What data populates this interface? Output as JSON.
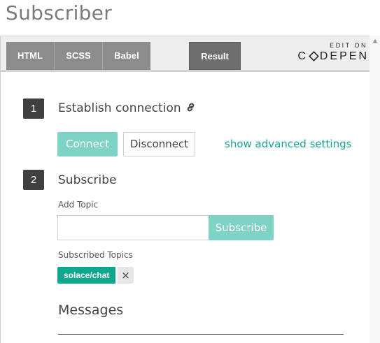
{
  "page": {
    "title": "Subscriber"
  },
  "embed": {
    "tabs": [
      {
        "label": "HTML"
      },
      {
        "label": "SCSS"
      },
      {
        "label": "Babel"
      }
    ],
    "result_tab": "Result",
    "edit_on": "EDIT ON",
    "codepen_brand": {
      "pre": "C",
      "post": "DEPEN"
    }
  },
  "steps": {
    "step1": {
      "number": "1",
      "title": "Establish connection",
      "connect_label": "Connect",
      "disconnect_label": "Disconnect",
      "advanced_link": "show advanced settings"
    },
    "step2": {
      "number": "2",
      "title": "Subscribe",
      "add_topic_label": "Add Topic",
      "topic_input_value": "",
      "subscribe_label": "Subscribe",
      "subscribed_topics_label": "Subscribed Topics",
      "topics": [
        "solace/chat"
      ],
      "remove_glyph": "×"
    }
  },
  "messages": {
    "title": "Messages"
  },
  "colors": {
    "accent": "#1aa58f",
    "button_disabled": "#7fd3c4",
    "chip": "#0fa88f",
    "badge": "#404040"
  }
}
